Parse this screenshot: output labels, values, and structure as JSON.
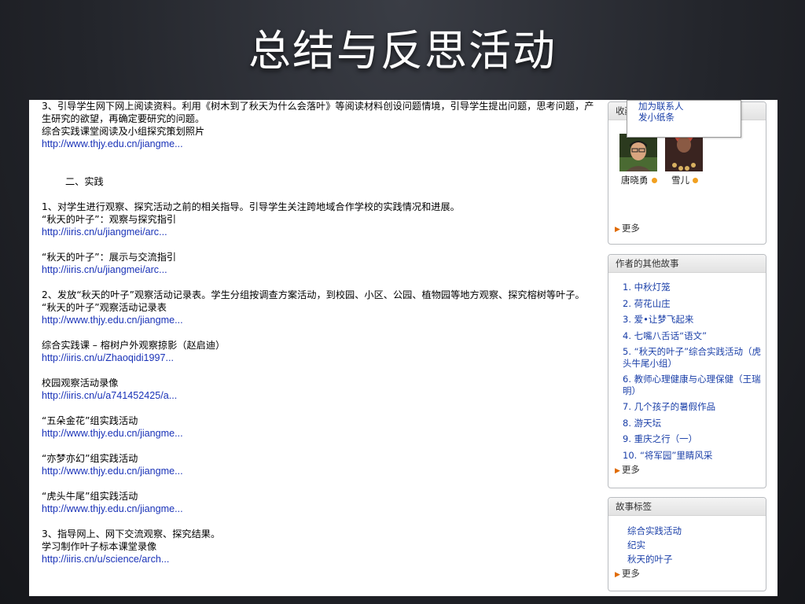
{
  "slide_title": "总结与反思活动",
  "main": {
    "step3_text": "3、引导学生网下网上阅读资料。利用《树木到了秋天为什么会落叶》等阅读材料创设问题情境，引导学生提出问题，思考问题，产生研究的欲望，再确定要研究的问题。",
    "step3_caption": "综合实践课堂阅读及小组探究策划照片",
    "step3_link": "http://www.thjy.edu.cn/jiangme...",
    "section_heading": "二、实践",
    "practice1_text": "1、对学生进行观察、探究活动之前的相关指导。引导学生关注跨地域合作学校的实践情况和进展。",
    "guide1_caption": "“秋天的叶子”：观察与探究指引",
    "guide1_link": "http://iiris.cn/u/jiangmei/arc...",
    "guide2_caption": "“秋天的叶子”：展示与交流指引",
    "guide2_link": "http://iiris.cn/u/jiangmei/arc...",
    "practice2_text": "2、发放“秋天的叶子”观察活动记录表。学生分组按调查方案活动，到校园、小区、公园、植物园等地方观察、探究榕树等叶子。",
    "record_caption": "“秋天的叶子”观察活动记录表",
    "record_link": "http://www.thjy.edu.cn/jiangme...",
    "photo_caption": "综合实践课 – 榕树户外观察掠影（赵启迪）",
    "photo_link": "http://iiris.cn/u/Zhaoqidi1997...",
    "video_caption": "校园观察活动录像",
    "video_link": "http://iiris.cn/u/a741452425/a...",
    "group1_caption": "“五朵金花”组实践活动",
    "group1_link": "http://www.thjy.edu.cn/jiangme...",
    "group2_caption": "“亦梦亦幻”组实践活动",
    "group2_link": "http://www.thjy.edu.cn/jiangme...",
    "group3_caption": "“虎头牛尾”组实践活动",
    "group3_link": "http://www.thjy.edu.cn/jiangme...",
    "step3b_text": "3、指导网上、网下交流观察、探究结果。",
    "specimen_caption": "学习制作叶子标本课堂录像",
    "specimen_link": "http://iiris.cn/u/science/arch..."
  },
  "sidebar": {
    "friends_box_head": "收藏",
    "popup": {
      "add_contact": "加为联系人",
      "send_note": "发小纸条"
    },
    "friends": [
      {
        "name": "唐晓勇"
      },
      {
        "name": "雪儿"
      }
    ],
    "friends_more": "更多",
    "stories_head": "作者的其他故事",
    "stories": [
      "1.  中秋灯笼",
      "2.  荷花山庄",
      "3.  爱•让梦飞起来",
      "4.  七嘴八舌话“语文”",
      "5.  “秋天的叶子”综合实践活动（虎头牛尾小组）",
      "6.  教师心理健康与心理保健（王瑞明）",
      "7.  几个孩子的暑假作品",
      "8.  游天坛",
      "9.  重庆之行（一）",
      "10.  “将军园”里睛风采"
    ],
    "stories_more": "更多",
    "tags_head": "故事标签",
    "tags": [
      "综合实践活动",
      "纪实",
      "秋天的叶子"
    ],
    "tags_more": "更多"
  },
  "colors": {
    "link": "#1a33b8",
    "more_arrow": "#e06a00",
    "online_dot": "#f1a020"
  }
}
